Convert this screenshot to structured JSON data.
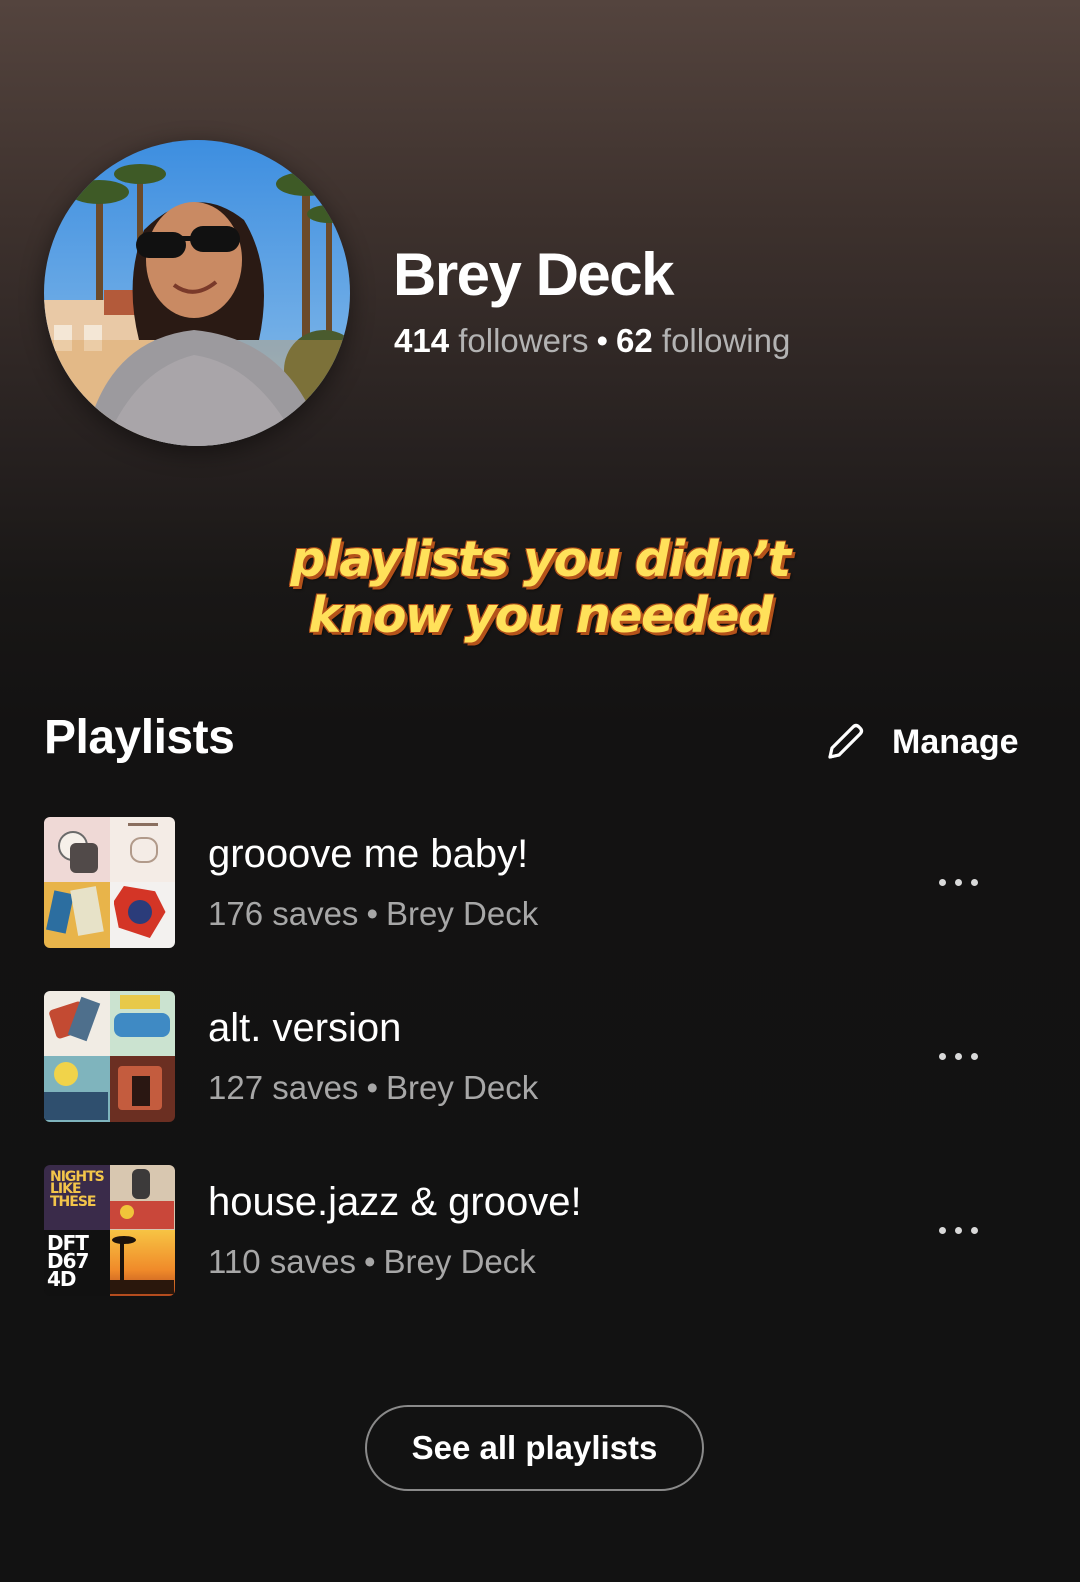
{
  "profile": {
    "name": "Brey Deck",
    "followers_count": "414",
    "followers_label": "followers",
    "separator": "•",
    "following_count": "62",
    "following_label": "following"
  },
  "caption": {
    "line1": "playlists you didn’t",
    "line2": "know you needed"
  },
  "playlists_section": {
    "title": "Playlists",
    "manage_label": "Manage",
    "items": [
      {
        "title": "grooove me baby!",
        "saves": "176 saves",
        "separator": "•",
        "owner": "Brey Deck"
      },
      {
        "title": "alt. version",
        "saves": "127 saves",
        "separator": "•",
        "owner": "Brey Deck"
      },
      {
        "title": "house.jazz & groove!",
        "saves": "110 saves",
        "separator": "•",
        "owner": "Brey Deck"
      }
    ],
    "cover_text": {
      "nights_like_these": "NIGHTS LIKE THESE",
      "daft": "DFT",
      "daft_sub": "D67",
      "daft_sub2": "4D"
    },
    "see_all_label": "See all playlists"
  },
  "colors": {
    "background": "#121212",
    "caption_fill": "#ffe15a",
    "caption_outline": "#b4521a",
    "secondary_text": "#a7a7a7"
  },
  "icons": {
    "manage": "pencil-icon",
    "row_menu": "more-dots-icon"
  }
}
